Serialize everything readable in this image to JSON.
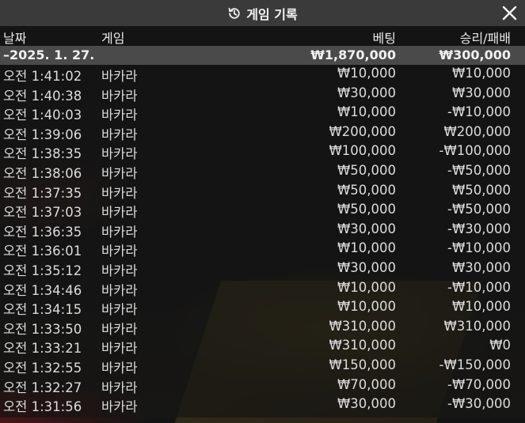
{
  "window": {
    "title": "게임 기록",
    "icon": "history-icon",
    "close_icon": "close-icon"
  },
  "columns": {
    "date": "날짜",
    "game": "게임",
    "bet": "베팅",
    "win_loss": "승리/패배"
  },
  "summary": {
    "date": "–2025. 1. 27.",
    "bet": "₩1,870,000",
    "win_loss": "₩300,000"
  },
  "rows": [
    {
      "time": "오전 1:41:02",
      "game": "바카라",
      "bet": "₩10,000",
      "result": "₩10,000"
    },
    {
      "time": "오전 1:40:38",
      "game": "바카라",
      "bet": "₩30,000",
      "result": "₩30,000"
    },
    {
      "time": "오전 1:40:03",
      "game": "바카라",
      "bet": "₩10,000",
      "result": "-₩10,000"
    },
    {
      "time": "오전 1:39:06",
      "game": "바카라",
      "bet": "₩200,000",
      "result": "₩200,000"
    },
    {
      "time": "오전 1:38:35",
      "game": "바카라",
      "bet": "₩100,000",
      "result": "-₩100,000"
    },
    {
      "time": "오전 1:38:06",
      "game": "바카라",
      "bet": "₩50,000",
      "result": "-₩50,000"
    },
    {
      "time": "오전 1:37:35",
      "game": "바카라",
      "bet": "₩50,000",
      "result": "₩50,000"
    },
    {
      "time": "오전 1:37:03",
      "game": "바카라",
      "bet": "₩50,000",
      "result": "-₩50,000"
    },
    {
      "time": "오전 1:36:35",
      "game": "바카라",
      "bet": "₩30,000",
      "result": "-₩30,000"
    },
    {
      "time": "오전 1:36:01",
      "game": "바카라",
      "bet": "₩10,000",
      "result": "-₩10,000"
    },
    {
      "time": "오전 1:35:12",
      "game": "바카라",
      "bet": "₩30,000",
      "result": "₩30,000"
    },
    {
      "time": "오전 1:34:46",
      "game": "바카라",
      "bet": "₩10,000",
      "result": "-₩10,000"
    },
    {
      "time": "오전 1:34:15",
      "game": "바카라",
      "bet": "₩10,000",
      "result": "₩10,000"
    },
    {
      "time": "오전 1:33:50",
      "game": "바카라",
      "bet": "₩310,000",
      "result": "₩310,000"
    },
    {
      "time": "오전 1:33:21",
      "game": "바카라",
      "bet": "₩310,000",
      "result": "₩0"
    },
    {
      "time": "오전 1:32:55",
      "game": "바카라",
      "bet": "₩150,000",
      "result": "-₩150,000"
    },
    {
      "time": "오전 1:32:27",
      "game": "바카라",
      "bet": "₩70,000",
      "result": "-₩70,000"
    },
    {
      "time": "오전 1:31:56",
      "game": "바카라",
      "bet": "₩30,000",
      "result": "-₩30,000"
    }
  ]
}
